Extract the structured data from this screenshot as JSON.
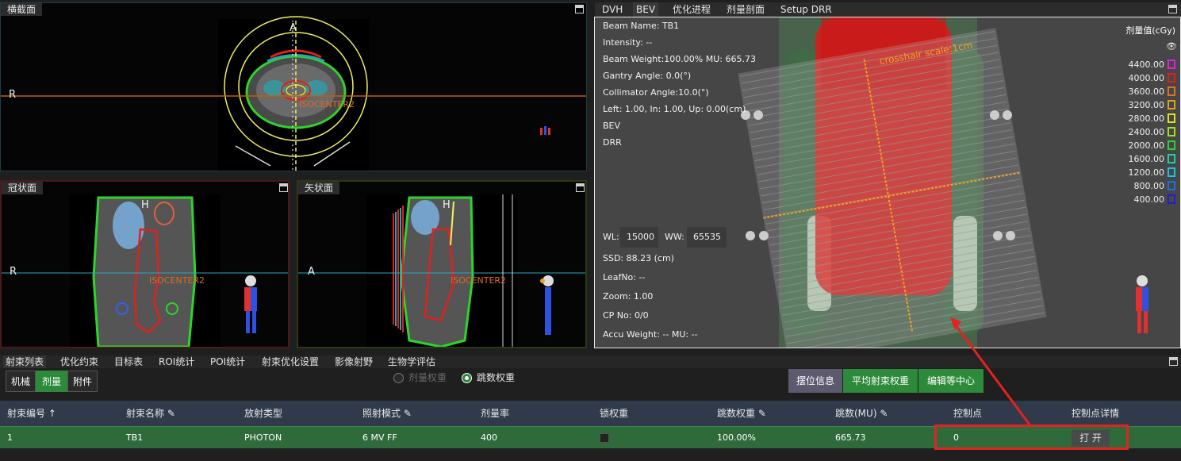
{
  "views": {
    "axial": {
      "title": "横截面",
      "anterior": "A",
      "right": "R",
      "isocenter": "ISOCENTER2"
    },
    "coronal": {
      "title": "冠状面",
      "head": "H",
      "right": "R",
      "isocenter": "ISOCENTER2"
    },
    "sagittal": {
      "title": "矢状面",
      "head": "H",
      "anterior": "A",
      "isocenter": "ISOCENTER2"
    }
  },
  "right_tabs": [
    "DVH",
    "BEV",
    "优化进程",
    "剂量剖面",
    "Setup DRR"
  ],
  "right_active_tab": "BEV",
  "bev": {
    "beam_name": "Beam Name: TB1",
    "intensity": "Intensity: --",
    "beam_weight": "Beam Weight:100.00% MU: 665.73",
    "gantry": "Gantry Angle: 0.0(°)",
    "collimator": "Collimator Angle:10.0(°)",
    "jaws": "Left: 1.00, In: 1.00, Up: 0.00(cm)",
    "mode1": "BEV",
    "mode2": "DRR",
    "crosshair": "crosshair scale:1cm",
    "wl_label": "WL:",
    "wl_value": "15000",
    "ww_label": "WW:",
    "ww_value": "65535",
    "ssd": "SSD: 88.23 (cm)",
    "leafno": "LeafNo: --",
    "zoom": "Zoom: 1.00",
    "cp": "CP No: 0/0",
    "accu": "Accu Weight: -- MU: --"
  },
  "dose_legend": {
    "title": "剂量值(cGy)",
    "levels": [
      {
        "label": "4400.00",
        "color": "#e020e0"
      },
      {
        "label": "4000.00",
        "color": "#e02020"
      },
      {
        "label": "3600.00",
        "color": "#e07020"
      },
      {
        "label": "3200.00",
        "color": "#e0a020"
      },
      {
        "label": "2800.00",
        "color": "#e0e020"
      },
      {
        "label": "2400.00",
        "color": "#a0e020"
      },
      {
        "label": "2000.00",
        "color": "#30d030"
      },
      {
        "label": "1600.00",
        "color": "#20d0a0"
      },
      {
        "label": "1200.00",
        "color": "#20c0e0"
      },
      {
        "label": "800.00",
        "color": "#2070e0"
      },
      {
        "label": "400.00",
        "color": "#2020d0"
      }
    ]
  },
  "bottom_tabs": [
    "射束列表",
    "优化约束",
    "目标表",
    "ROI统计",
    "POI统计",
    "射束优化设置",
    "影像射野",
    "生物学评估"
  ],
  "bottom_active_tab": "射束列表",
  "segment": {
    "machine": "机械",
    "dose": "剂量",
    "accessory": "附件"
  },
  "weight_radio": {
    "dose_weight": "剂量权重",
    "mu_weight": "跳数权重"
  },
  "actions": {
    "setup_info": "摆位信息",
    "avg_weight": "平均射束权重",
    "edit_iso": "编辑等中心"
  },
  "table": {
    "headers": [
      "射束编号 ↑",
      "射束名称",
      "放射类型",
      "照射模式",
      "剂量率",
      "锁权重",
      "跳数权重",
      "跳数(MU)",
      "控制点",
      "控制点详情"
    ],
    "rows": [
      {
        "id": "1",
        "name": "TB1",
        "type": "PHOTON",
        "mode": "6 MV FF",
        "rate": "400",
        "weight": "100.00%",
        "mu": "665.73",
        "cp": "0",
        "detail": "打 开"
      }
    ]
  },
  "colors": {
    "accent_green": "#2d8a3a",
    "highlight_red": "#e32222"
  }
}
